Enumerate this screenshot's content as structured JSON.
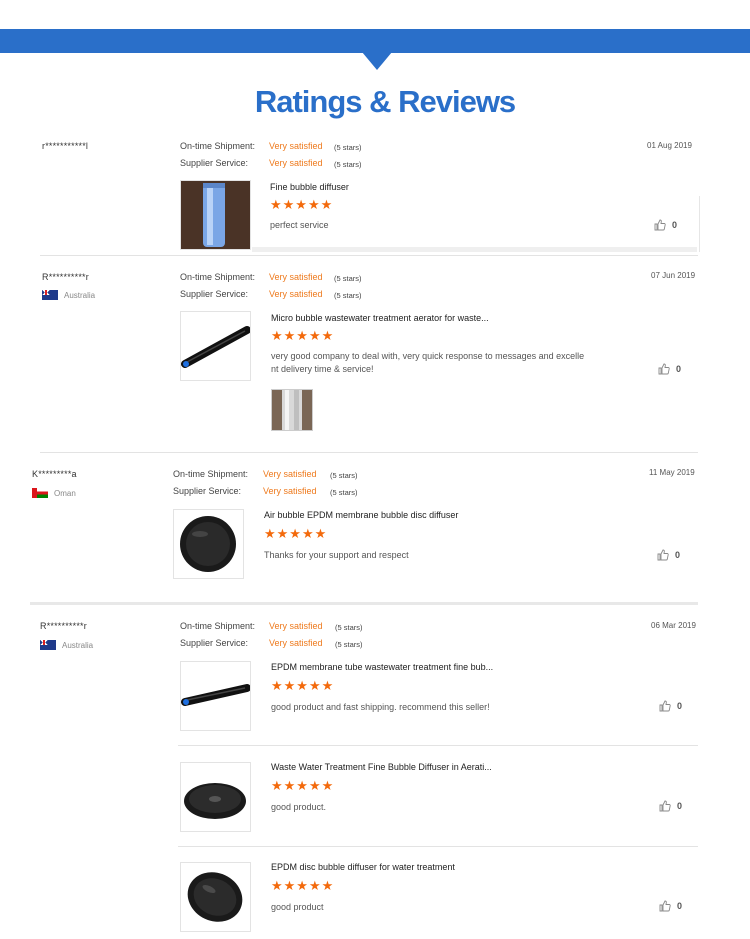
{
  "header": {
    "title": "Ratings & Reviews"
  },
  "labels": {
    "on_time": "On-time Shipment:",
    "supplier": "Supplier Service:",
    "stars_glyphs": "★★★★★"
  },
  "reviews": [
    {
      "reviewer": "r***********l",
      "country": "",
      "date": "01 Aug 2019",
      "on_time_value": "Very satisfied",
      "on_time_stars": "(5 stars)",
      "supplier_value": "Very satisfied",
      "supplier_stars": "(5 stars)",
      "products": [
        {
          "title": "Fine bubble diffuser",
          "comment": "perfect service",
          "likes": "0",
          "image_icon": "blue-tube-diffuser-icon"
        }
      ]
    },
    {
      "reviewer": "R**********r",
      "country": "Australia",
      "date": "07 Jun 2019",
      "on_time_value": "Very satisfied",
      "on_time_stars": "(5 stars)",
      "supplier_value": "Very satisfied",
      "supplier_stars": "(5 stars)",
      "products": [
        {
          "title": "Micro bubble wastewater treatment aerator for waste...",
          "comment_line1": "very good company to deal with, very quick response to messages and excelle",
          "comment_line2": "nt delivery time & service!",
          "likes": "0",
          "image_icon": "black-tube-aerator-icon"
        }
      ]
    },
    {
      "reviewer": "K*********a",
      "country": "Oman",
      "date": "11 May 2019",
      "on_time_value": "Very satisfied",
      "on_time_stars": "(5 stars)",
      "supplier_value": "Very satisfied",
      "supplier_stars": "(5 stars)",
      "products": [
        {
          "title": "Air bubble EPDM membrane bubble disc diffuser",
          "comment": "Thanks for your support and respect",
          "likes": "0",
          "image_icon": "disc-diffuser-icon"
        }
      ]
    },
    {
      "reviewer": "R**********r",
      "country": "Australia",
      "date": "06 Mar 2019",
      "on_time_value": "Very satisfied",
      "on_time_stars": "(5 stars)",
      "supplier_value": "Very satisfied",
      "supplier_stars": "(5 stars)",
      "products": [
        {
          "title": "EPDM membrane tube wastewater treatment fine bub...",
          "comment": "good product and fast shipping. recommend this seller!",
          "likes": "0",
          "image_icon": "black-tube-diffuser-icon"
        },
        {
          "title": "Waste Water Treatment Fine Bubble Diffuser in Aerati...",
          "comment": "good product.",
          "likes": "0",
          "image_icon": "disc-diffuser-icon"
        },
        {
          "title": "EPDM disc bubble diffuser for water treatment",
          "comment": "good product",
          "likes": "0",
          "image_icon": "disc-diffuser-icon"
        }
      ]
    }
  ],
  "colors": {
    "brand_blue": "#2a6fc9",
    "accent_orange": "#ee7a1d",
    "star_orange": "#f36a0c"
  }
}
